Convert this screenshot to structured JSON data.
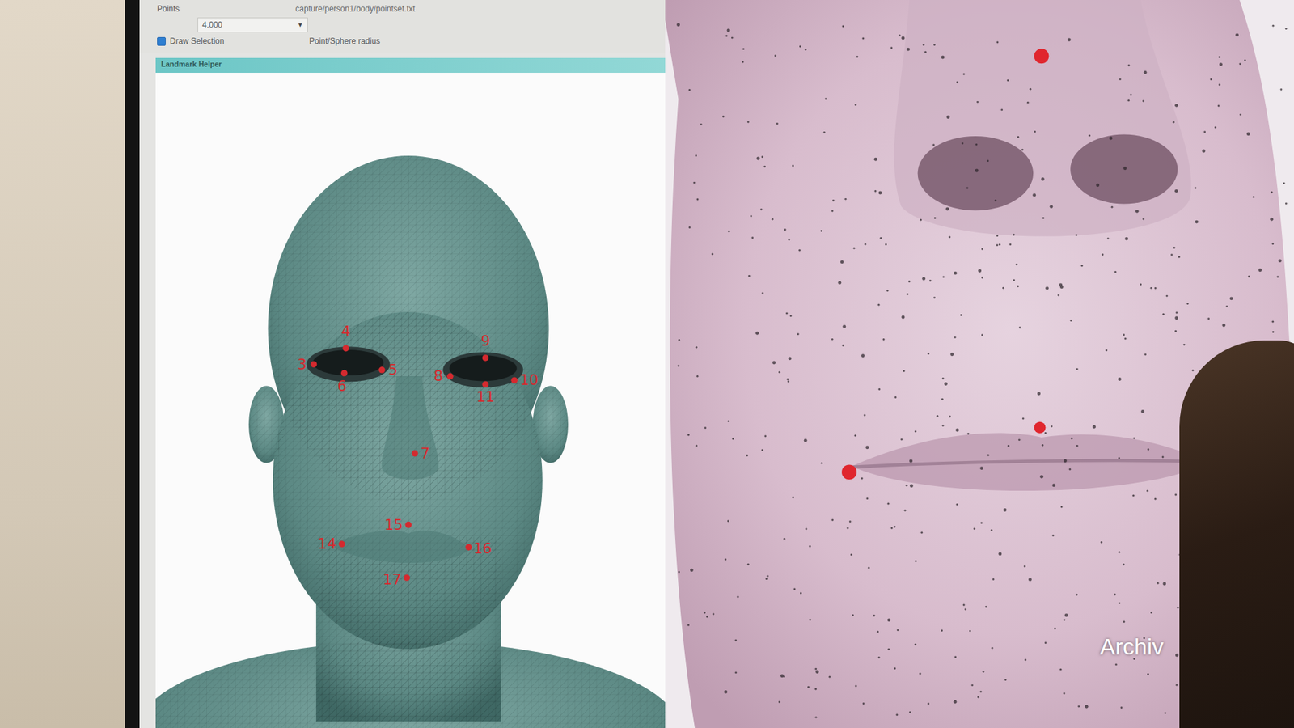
{
  "toolbar": {
    "path": "capture/person1/body/pointset.txt",
    "points_label": "Points",
    "radius_value": "4.000",
    "dropdown_icon": "▼",
    "draw_selection": {
      "label": "Draw Selection",
      "checked": true
    },
    "radius_label": "Point/Sphere radius"
  },
  "landmark_panel": {
    "title": "Landmark Helper",
    "landmarks": [
      {
        "label": "4"
      },
      {
        "label": "3"
      },
      {
        "label": "5"
      },
      {
        "label": "6"
      },
      {
        "label": "9"
      },
      {
        "label": "8"
      },
      {
        "label": "10"
      },
      {
        "label": "11"
      },
      {
        "label": "7"
      },
      {
        "label": "15"
      },
      {
        "label": "14"
      },
      {
        "label": "16"
      },
      {
        "label": "17"
      }
    ]
  },
  "watermark": "Archiv"
}
